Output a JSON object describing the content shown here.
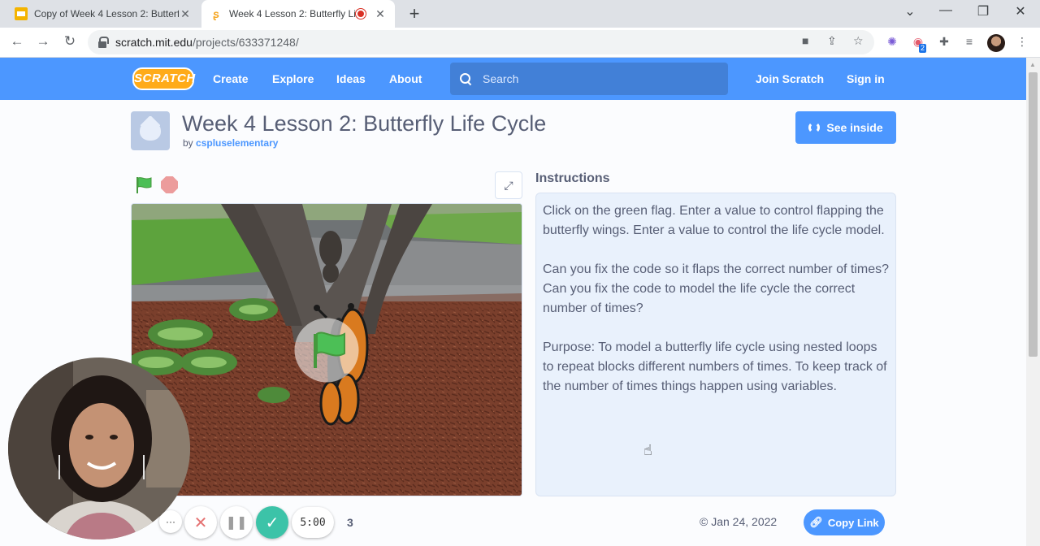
{
  "browser": {
    "tabs": [
      {
        "title": "Copy of Week 4 Lesson 2: Butterfl"
      },
      {
        "title": "Week 4 Lesson 2: Butterfly Li"
      }
    ],
    "url_host": "scratch.mit.edu",
    "url_path": "/projects/633371248/",
    "extension_badge": "2"
  },
  "navbar": {
    "logo": "SCRATCH",
    "links": [
      "Create",
      "Explore",
      "Ideas",
      "About"
    ],
    "search_placeholder": "Search",
    "join": "Join Scratch",
    "signin": "Sign in"
  },
  "project": {
    "title": "Week 4 Lesson 2: Butterfly Life Cycle",
    "by_prefix": "by",
    "author": "cspluselementary",
    "see_inside": "See inside",
    "instructions_heading": "Instructions",
    "instructions": [
      "Click on the green flag. Enter a value to control flapping the butterfly wings. Enter a value to control the life cycle model.",
      "Can you fix the code so it flaps the correct number of times? Can you fix the code to model the life cycle the correct number of times?",
      "Purpose: To model a butterfly life cycle using nested loops to repeat blocks different numbers of times. To keep track of the number of times things happen using variables."
    ],
    "date": "Jan 24, 2022",
    "copy_link": "Copy Link"
  },
  "recorder": {
    "timer": "5:00",
    "count": "3"
  },
  "colors": {
    "scratch_blue": "#4c97ff",
    "green_flag": "#4cbf56",
    "stop": "#ec9c9c",
    "recorder_done": "#3cc3a8"
  }
}
